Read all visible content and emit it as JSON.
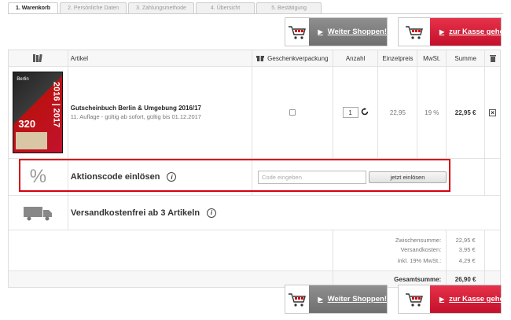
{
  "tabs": [
    "1. Warenkorb",
    "2. Persönliche Daten",
    "3. Zahlungsmethode",
    "4. Übersicht",
    "5. Bestätigung"
  ],
  "buttons": {
    "continue": "Weiter Shoppen!",
    "checkout": "zur Kasse gehen"
  },
  "table": {
    "headers": {
      "article": "Artikel",
      "gift": "Geschenkverpackung",
      "qty": "Anzahl",
      "unit_price": "Einzelpreis",
      "vat": "MwSt.",
      "sum": "Summe"
    },
    "item": {
      "title": "Gutscheinbuch Berlin & Umgebung 2016/17",
      "subtitle": "11. Auflage - gültig ab sofort, gültig bis 01.12.2017",
      "qty": "1",
      "unit_price": "22,95",
      "vat": "19 %",
      "sum": "22,95 €",
      "cover": {
        "title": "Berlin",
        "year": "2016 | 2017",
        "number": "320"
      }
    },
    "promo": {
      "label": "Aktionscode einlösen",
      "placeholder": "Code eingeben",
      "button": "jetzt einlösen"
    },
    "shipping": {
      "label": "Versandkostenfrei ab 3 Artikeln"
    },
    "totals": {
      "subtotal_label": "Zwischensumme:",
      "subtotal": "22,95 €",
      "shipping_label": "Versandkosten:",
      "shipping": "3,95 €",
      "vat_label": "inkl. 19% MwSt.:",
      "vat": "4,29 €",
      "grand_label": "Gesamtsumme:",
      "grand": "26,90 €"
    }
  },
  "colors": {
    "accent_red": "#d7000f",
    "button_grey": "#7f7f7f"
  }
}
